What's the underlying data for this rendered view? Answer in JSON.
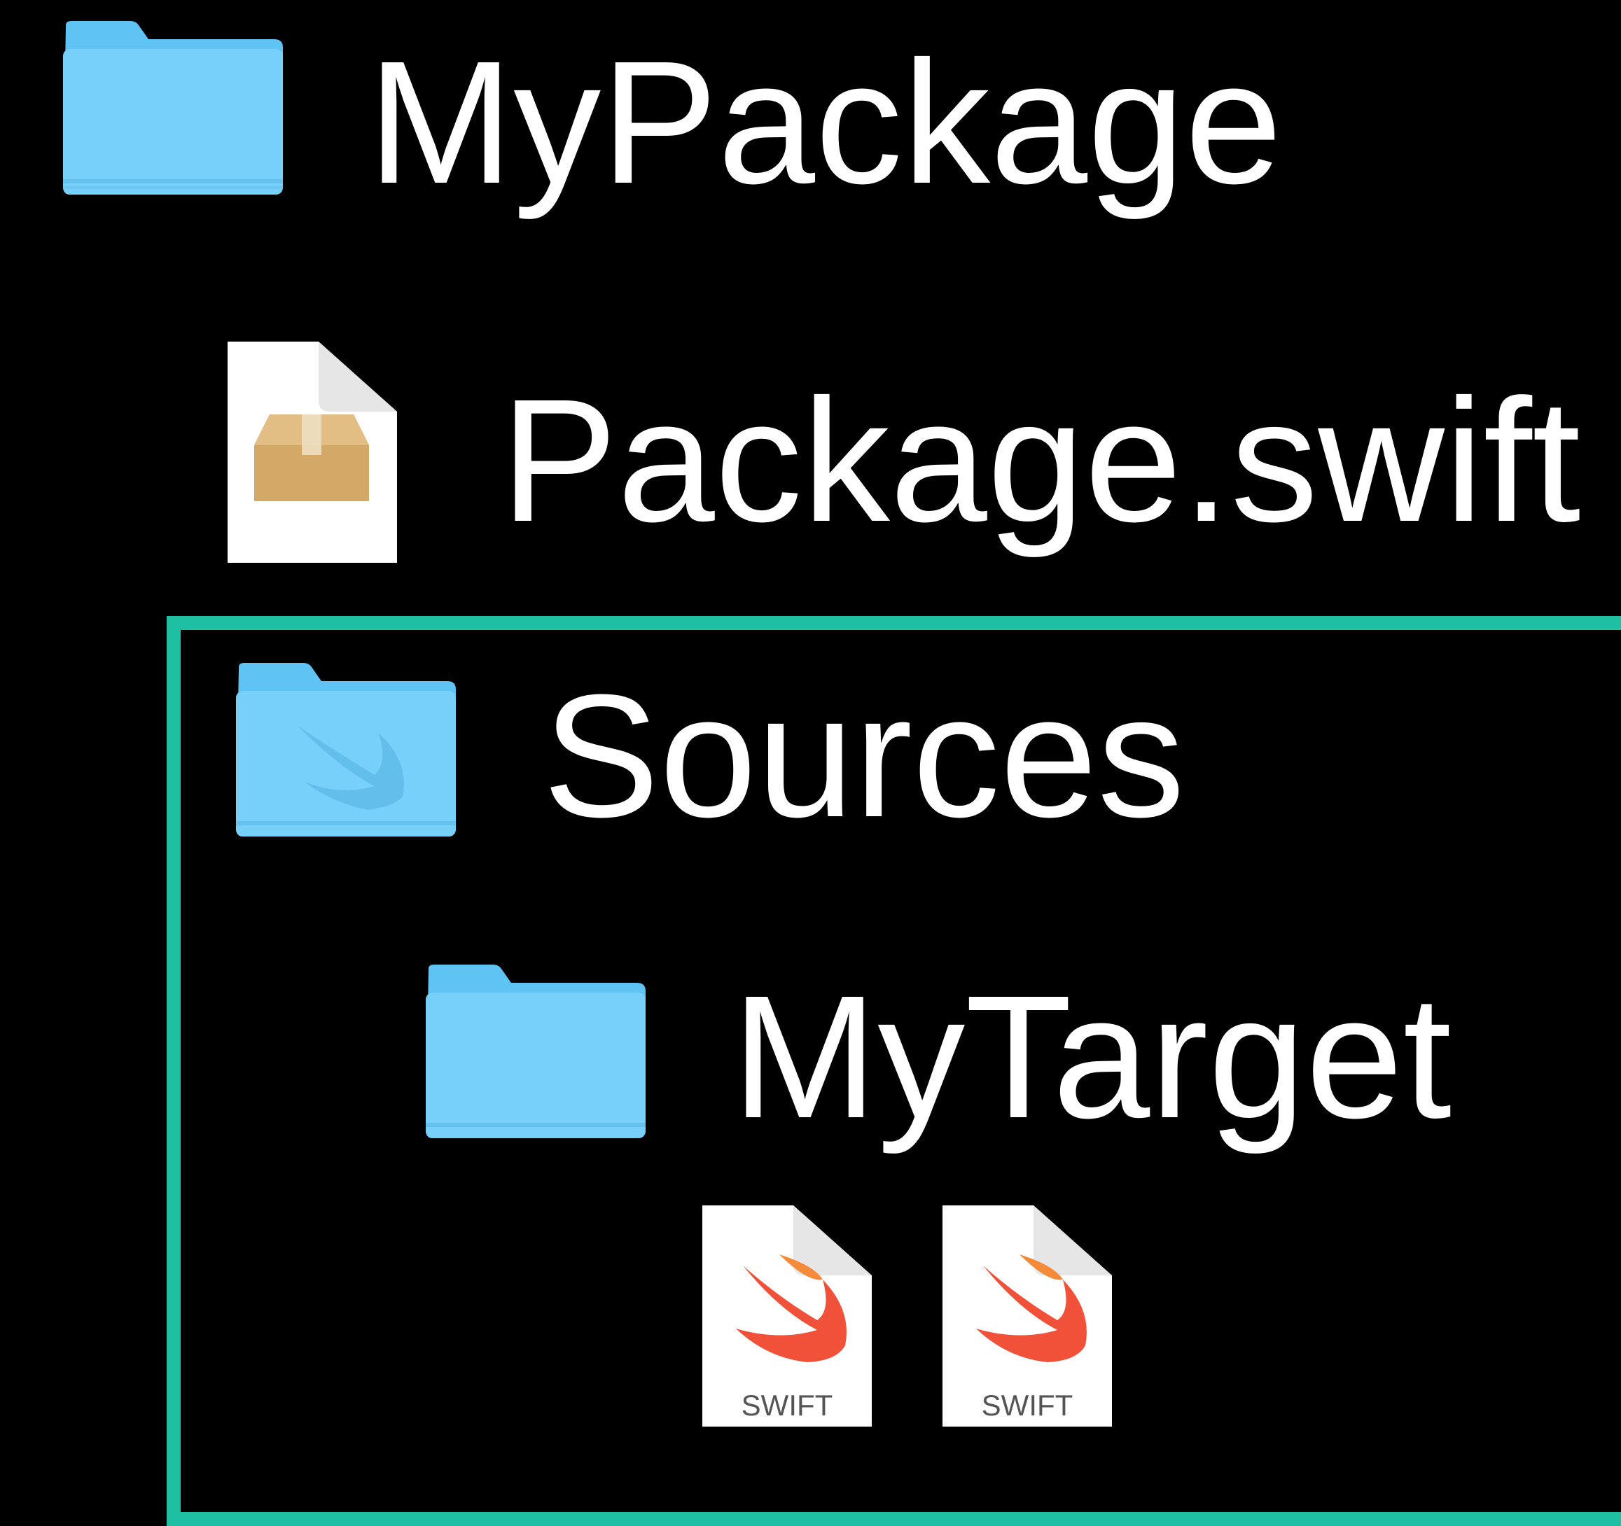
{
  "colors": {
    "background": "#000000",
    "text": "#ffffff",
    "selection_outline": "#1ebfa2",
    "folder_blue": "#6ccdf8",
    "folder_tab": "#5fc3f3",
    "package_box": "#d2a865"
  },
  "tree": {
    "root": {
      "label": "MyPackage",
      "icon": "folder-icon"
    },
    "manifest": {
      "label": "Package.swift",
      "icon": "package-file-icon"
    },
    "sources": {
      "label": "Sources",
      "icon": "swift-folder-icon"
    },
    "target": {
      "label": "MyTarget",
      "icon": "folder-icon"
    },
    "files": [
      {
        "icon": "swift-file-icon",
        "badge": "SWIFT"
      },
      {
        "icon": "swift-file-icon",
        "badge": "SWIFT"
      }
    ]
  }
}
